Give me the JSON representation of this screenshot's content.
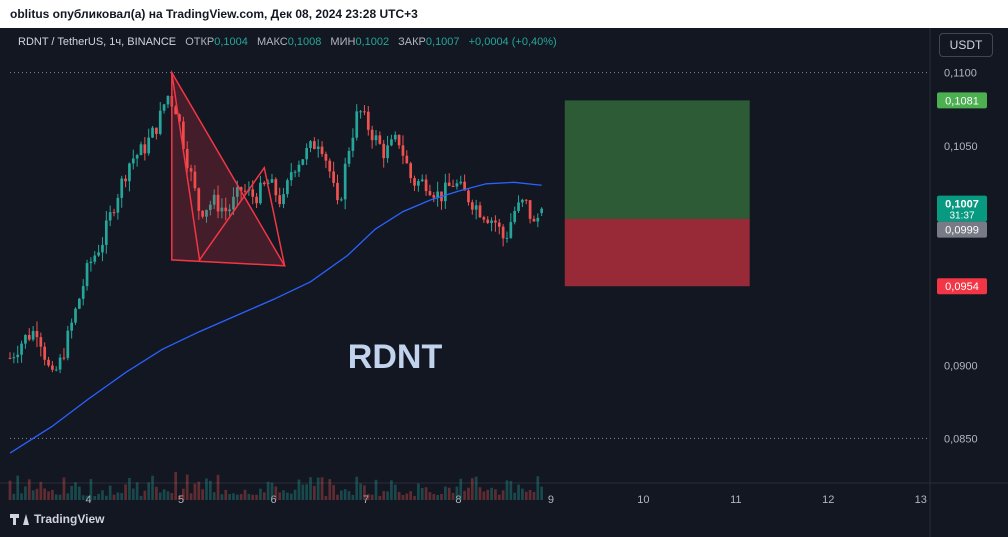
{
  "header": {
    "publisher_text": "oblitus опубликовал(а) на TradingView.com, Дек 08, 2024 23:28 UTC+3"
  },
  "legend": {
    "symbol": "RDNT / TetherUS, 1ч, BINANCE",
    "open_label": "ОТКР",
    "open_value": "0,1004",
    "high_label": "МАКС",
    "high_value": "0,1008",
    "low_label": "МИН",
    "low_value": "0,1002",
    "close_label": "ЗАКР",
    "close_value": "0,1007",
    "change": "+0,0004 (+0,40%)"
  },
  "currency_button": "USDT",
  "watermark": "RDNT",
  "footer": {
    "brand": "TradingView"
  },
  "colors": {
    "background": "#131722",
    "up": "#26a69a",
    "down": "#ef5350",
    "ma_line": "#2962ff",
    "pattern": "#f23645",
    "target_zone": "#4caf50",
    "stop_zone": "#f23645"
  },
  "chart_data": {
    "type": "candlestick",
    "timeframe": "1h",
    "x_axis": {
      "tick_labels": [
        "4",
        "5",
        "6",
        "7",
        "8",
        "9",
        "10",
        "11",
        "12",
        "13"
      ],
      "range_days": [
        3.15,
        13.1
      ]
    },
    "y_axis": {
      "tick_labels": [
        "0,1100",
        "0,1050",
        "0,0900",
        "0,0850"
      ],
      "tick_values": [
        0.11,
        0.105,
        0.09,
        0.085
      ],
      "range": [
        0.0825,
        0.1125
      ]
    },
    "price_badges": [
      {
        "label": "0,1081",
        "value": 0.1081,
        "kind": "target"
      },
      {
        "label": "0,1007",
        "value": 0.1007,
        "kind": "last",
        "sub": "31:37"
      },
      {
        "label": "0,0999",
        "value": 0.0999,
        "kind": "ma"
      },
      {
        "label": "0,0954",
        "value": 0.0954,
        "kind": "stop"
      }
    ],
    "dotted_levels": [
      0.11,
      0.085
    ],
    "position_tool": {
      "x_start_day": 9.15,
      "x_end_day": 11.15,
      "entry": 0.1,
      "target": 0.1081,
      "stop": 0.0954
    },
    "pattern_triangle": [
      {
        "day": 4.9,
        "price": 0.11
      },
      {
        "day": 6.12,
        "price": 0.0968
      },
      {
        "day": 4.9,
        "price": 0.0972
      }
    ],
    "pattern_zigzag": [
      {
        "day": 4.9,
        "price": 0.11
      },
      {
        "day": 5.2,
        "price": 0.0972
      },
      {
        "day": 5.9,
        "price": 0.1035
      },
      {
        "day": 6.12,
        "price": 0.0968
      }
    ],
    "moving_average": [
      [
        3.15,
        0.084
      ],
      [
        3.6,
        0.0858
      ],
      [
        4.0,
        0.0877
      ],
      [
        4.4,
        0.0895
      ],
      [
        4.8,
        0.0911
      ],
      [
        5.2,
        0.0923
      ],
      [
        5.6,
        0.0934
      ],
      [
        6.0,
        0.0945
      ],
      [
        6.4,
        0.0957
      ],
      [
        6.8,
        0.0975
      ],
      [
        7.1,
        0.0993
      ],
      [
        7.4,
        0.1005
      ],
      [
        7.7,
        0.1013
      ],
      [
        8.0,
        0.1019
      ],
      [
        8.3,
        0.1024
      ],
      [
        8.6,
        0.1025
      ],
      [
        8.9,
        0.1023
      ]
    ],
    "close_path": [
      [
        3.15,
        0.0905
      ],
      [
        3.3,
        0.0918
      ],
      [
        3.45,
        0.0925
      ],
      [
        3.6,
        0.089
      ],
      [
        3.7,
        0.0903
      ],
      [
        3.85,
        0.0935
      ],
      [
        4.0,
        0.0968
      ],
      [
        4.15,
        0.0985
      ],
      [
        4.3,
        0.1015
      ],
      [
        4.45,
        0.104
      ],
      [
        4.6,
        0.1048
      ],
      [
        4.75,
        0.1065
      ],
      [
        4.85,
        0.1085
      ],
      [
        4.95,
        0.1075
      ],
      [
        5.05,
        0.1045
      ],
      [
        5.2,
        0.1005
      ],
      [
        5.35,
        0.1012
      ],
      [
        5.5,
        0.1005
      ],
      [
        5.65,
        0.102
      ],
      [
        5.8,
        0.1015
      ],
      [
        5.95,
        0.1025
      ],
      [
        6.1,
        0.101
      ],
      [
        6.2,
        0.1035
      ],
      [
        6.35,
        0.1045
      ],
      [
        6.5,
        0.1055
      ],
      [
        6.6,
        0.1035
      ],
      [
        6.7,
        0.1005
      ],
      [
        6.8,
        0.1045
      ],
      [
        6.92,
        0.1075
      ],
      [
        7.05,
        0.106
      ],
      [
        7.2,
        0.1045
      ],
      [
        7.35,
        0.1055
      ],
      [
        7.5,
        0.1025
      ],
      [
        7.65,
        0.1025
      ],
      [
        7.8,
        0.1015
      ],
      [
        7.95,
        0.1025
      ],
      [
        8.1,
        0.1015
      ],
      [
        8.25,
        0.1005
      ],
      [
        8.4,
        0.0998
      ],
      [
        8.5,
        0.0985
      ],
      [
        8.6,
        0.1005
      ],
      [
        8.72,
        0.1012
      ],
      [
        8.82,
        0.0995
      ],
      [
        8.9,
        0.1007
      ]
    ]
  }
}
